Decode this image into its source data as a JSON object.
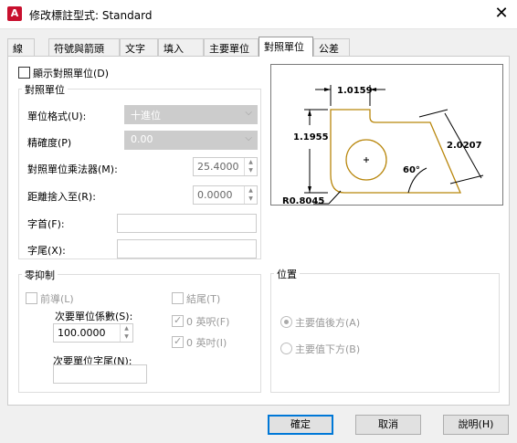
{
  "window": {
    "title": "修改標註型式: Standard",
    "app_icon": "A",
    "close_glyph": "✕"
  },
  "tabs": [
    "線",
    "符號與箭頭",
    "文字",
    "填入",
    "主要單位",
    "對照單位",
    "公差"
  ],
  "display_alt": {
    "label": "顯示對照單位(D)"
  },
  "alt_units": {
    "group_title": "對照單位",
    "unit_format_label": "單位格式(U):",
    "unit_format_value": "十進位",
    "precision_label": "精確度(P)",
    "precision_value": "0.00",
    "multiplier_label": "對照單位乘法器(M):",
    "multiplier_value": "25.4000",
    "round_label": "距離捨入至(R):",
    "round_value": "0.0000",
    "prefix_label": "字首(F):",
    "suffix_label": "字尾(X):"
  },
  "zero_suppression": {
    "group_title": "零抑制",
    "leading_label": "前導(L)",
    "sub_factor_label": "次要單位係數(S):",
    "sub_factor_value": "100.0000",
    "sub_suffix_label": "次要單位字尾(N):",
    "trailing_label": "結尾(T)",
    "feet_label": "0 英呎(F)",
    "inches_label": "0 英吋(I)"
  },
  "placement": {
    "group_title": "位置",
    "after_label": "主要值後方(A)",
    "below_label": "主要值下方(B)"
  },
  "preview": {
    "dim_top": "1.0159",
    "dim_left": "1.1955",
    "dim_right": "2.0207",
    "angle": "60°",
    "radius": "R0.8045"
  },
  "buttons": {
    "ok": "確定",
    "cancel": "取消",
    "help": "說明(H)"
  }
}
